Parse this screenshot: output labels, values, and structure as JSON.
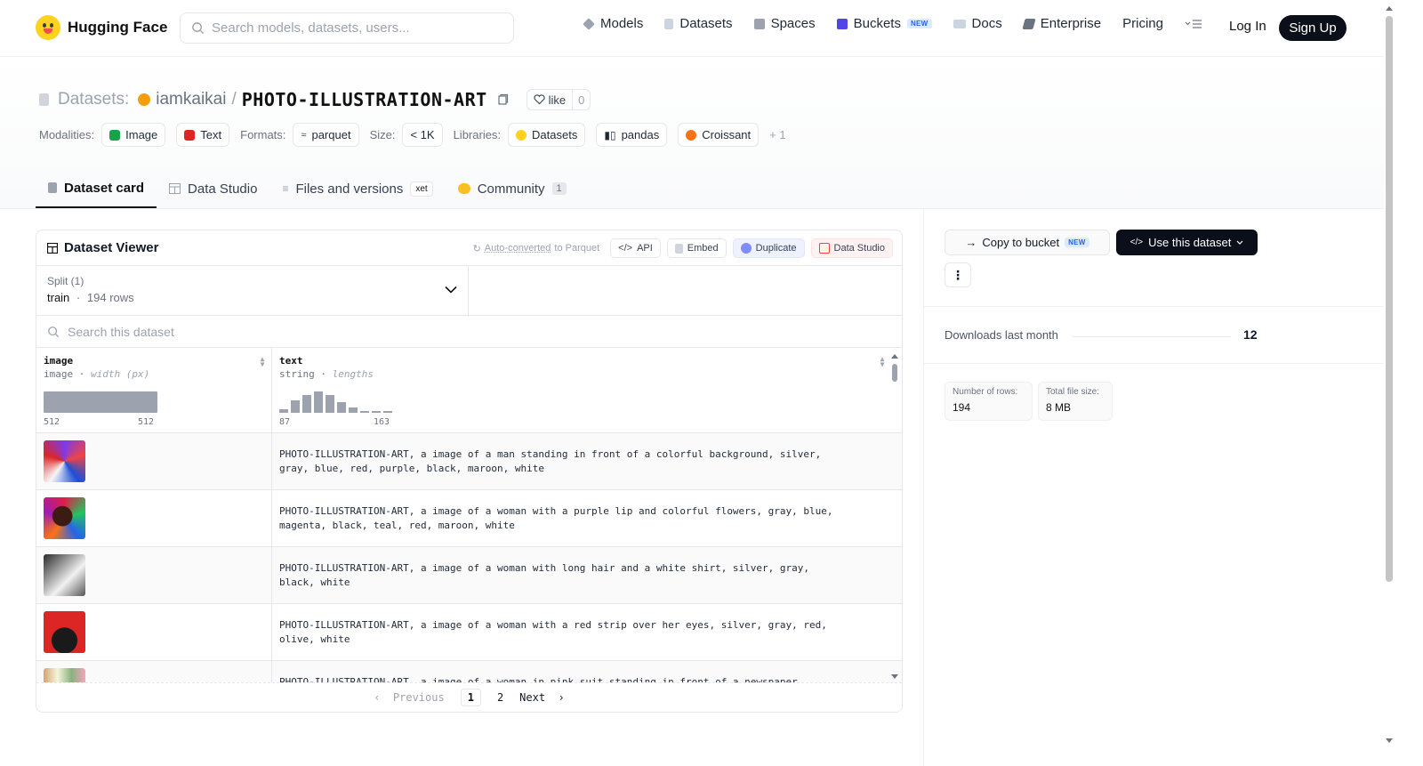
{
  "nav": {
    "brand": "Hugging Face",
    "search_placeholder": "Search models, datasets, users...",
    "links": {
      "models": "Models",
      "datasets": "Datasets",
      "spaces": "Spaces",
      "buckets": "Buckets",
      "buckets_badge": "NEW",
      "docs": "Docs",
      "enterprise": "Enterprise",
      "pricing": "Pricing"
    },
    "login": "Log In",
    "signup": "Sign Up"
  },
  "header": {
    "prefix": "Datasets:",
    "user": "iamkaikai",
    "separator": "/",
    "name": "PHOTO-ILLUSTRATION-ART",
    "like_label": "like",
    "like_count": "0"
  },
  "tags": {
    "modalities_label": "Modalities:",
    "modalities": [
      "Image",
      "Text"
    ],
    "formats_label": "Formats:",
    "format": "parquet",
    "size_label": "Size:",
    "size": "< 1K",
    "libraries_label": "Libraries:",
    "libraries": [
      "Datasets",
      "pandas",
      "Croissant"
    ],
    "libraries_more": "+ 1"
  },
  "tabs": {
    "card": "Dataset card",
    "studio": "Data Studio",
    "files": "Files and versions",
    "files_badge": "xet",
    "community": "Community",
    "community_count": "1"
  },
  "viewer": {
    "title": "Dataset Viewer",
    "autoconv_link": "Auto-converted",
    "autoconv_rest": "to Parquet",
    "api": "API",
    "embed": "Embed",
    "duplicate": "Duplicate",
    "data_studio": "Data Studio",
    "split_label": "Split (1)",
    "split_name": "train",
    "split_dot": "·",
    "split_rows": "194 rows",
    "search_placeholder": "Search this dataset",
    "col1": {
      "name": "image",
      "type": "image",
      "stat_label": "width (px)",
      "min": "512",
      "max": "512"
    },
    "col2": {
      "name": "text",
      "type": "string",
      "stat_label": "lengths",
      "min": "87",
      "max": "163",
      "histogram": [
        2,
        7,
        10,
        12,
        10,
        6,
        3,
        1,
        1,
        1
      ]
    },
    "rows": [
      {
        "text": "PHOTO-ILLUSTRATION-ART, a image of a man standing in front of a colorful background, silver,\ngray, blue, red, purple, black, maroon, white"
      },
      {
        "text": "PHOTO-ILLUSTRATION-ART, a image of a woman with a purple lip and colorful flowers, gray, blue,\nmagenta, black, teal, red, maroon, white"
      },
      {
        "text": "PHOTO-ILLUSTRATION-ART, a image of a woman with long hair and a white shirt, silver, gray,\nblack, white"
      },
      {
        "text": "PHOTO-ILLUSTRATION-ART, a image of a woman with a red strip over her eyes, silver, gray, red,\nolive, white"
      },
      {
        "text": "PHOTO-ILLUSTRATION-ART, a image of a woman in pink suit standing in front of a newspaper"
      }
    ],
    "pager": {
      "prev": "Previous",
      "p1": "1",
      "p2": "2",
      "next": "Next"
    }
  },
  "sidebar": {
    "copy_bucket": "Copy to bucket",
    "copy_badge": "NEW",
    "use_dataset": "Use this dataset",
    "downloads_label": "Downloads last month",
    "downloads_value": "12",
    "rows_label": "Number of rows:",
    "rows_value": "194",
    "size_label": "Total file size:",
    "size_value": "8 MB"
  },
  "colors": {
    "accent_dark": "#0b0f19",
    "brand_yellow": "#ffd21e"
  }
}
